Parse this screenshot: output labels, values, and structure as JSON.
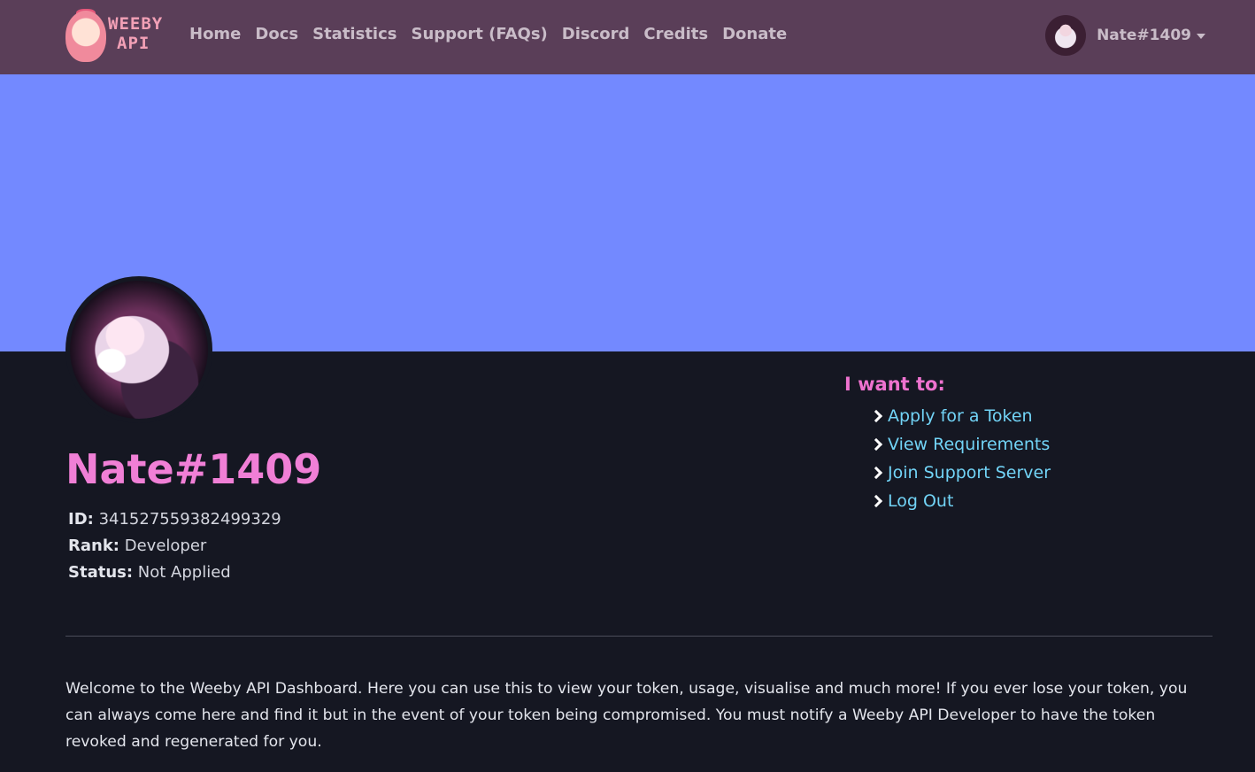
{
  "nav": {
    "logo_text_line1": "WEEBY",
    "logo_text_line2": "API",
    "links": [
      "Home",
      "Docs",
      "Statistics",
      "Support (FAQs)",
      "Discord",
      "Credits",
      "Donate"
    ],
    "username": "Nate#1409"
  },
  "profile": {
    "name": "Nate#1409",
    "id_label": "ID:",
    "id_value": "341527559382499329",
    "rank_label": "Rank:",
    "rank_value": "Developer",
    "status_label": "Status:",
    "status_value": "Not Applied"
  },
  "actions": {
    "title": "I want to:",
    "items": [
      "Apply for a Token",
      "View Requirements",
      "Join Support Server",
      "Log Out"
    ]
  },
  "welcome_text": "Welcome to the Weeby API Dashboard. Here you can use this to view your token, usage, visualise and much more! If you ever lose your token, you can always come here and find it but in the event of your token being compromised. You must notify a Weeby API Developer to have the token revoked and regenerated for you.",
  "colors": {
    "navbar": "#5a3e58",
    "banner": "#7389ff",
    "background": "#151722",
    "accent_pink": "#f07fd6",
    "link_blue": "#72d4f7"
  }
}
